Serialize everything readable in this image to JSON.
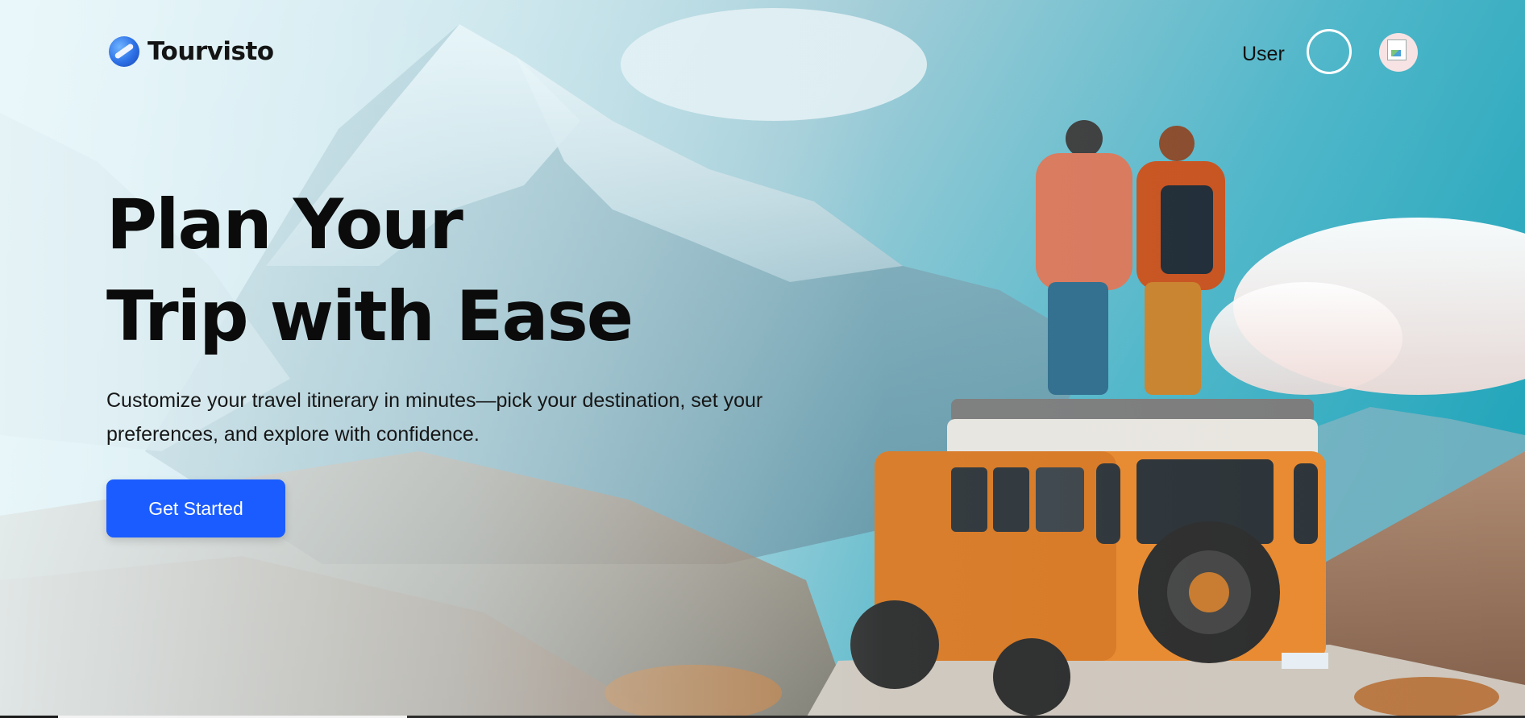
{
  "brand": {
    "name": "Tourvisto",
    "logo_icon": "globe-airplane-icon"
  },
  "nav": {
    "user_label": "User"
  },
  "hero": {
    "headline_line1": "Plan Your",
    "headline_line2": "Trip with Ease",
    "subtext": "Customize your travel itinerary in minutes—pick your destination, set your preferences, and explore with confidence.",
    "cta_label": "Get Started",
    "background": "mountain-jeep-travelers-photo"
  },
  "colors": {
    "cta": "#1a5cff",
    "headline": "#0b0b0b",
    "sky": "#129fb5"
  }
}
